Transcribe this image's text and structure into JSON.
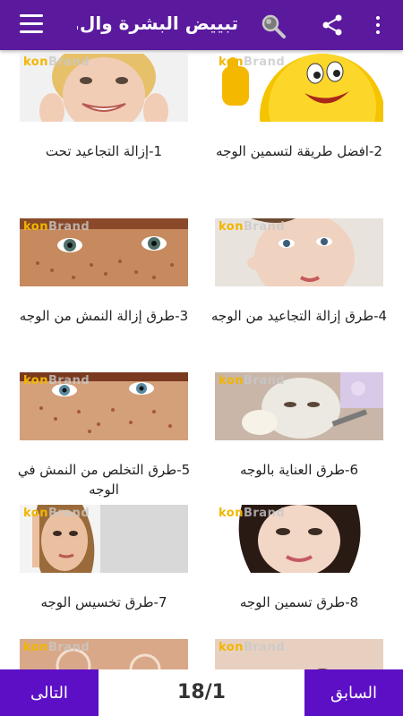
{
  "appbar": {
    "title": "تبييض البشرة وال..",
    "icons": [
      "menu-icon",
      "search-icon",
      "share-icon",
      "more-vert-icon"
    ]
  },
  "brand_watermark": {
    "accent": "kon",
    "rest": "Brand"
  },
  "articles": [
    {
      "label": "2-افضل طريقة لتسمين الوجه"
    },
    {
      "label": "1-إزالة التجاعيد تحت"
    },
    {
      "label": "4-طرق إزالة التجاعيد من الوجه"
    },
    {
      "label": "3-طرق إزالة النمش من الوجه"
    },
    {
      "label": "6-طرق العناية بالوجه"
    },
    {
      "label": "5-طرق التخلص من النمش في الوجه"
    },
    {
      "label": "8-طرق تسمين الوجه"
    },
    {
      "label": "7-طرق تخسيس الوجه"
    }
  ],
  "pagination": {
    "next_label": "التالى",
    "prev_label": "السابق",
    "counter": "18/1"
  },
  "colors": {
    "appbar": "#5b1a9e",
    "buttons": "#5d0fc5",
    "brand_accent": "#f1b600"
  }
}
